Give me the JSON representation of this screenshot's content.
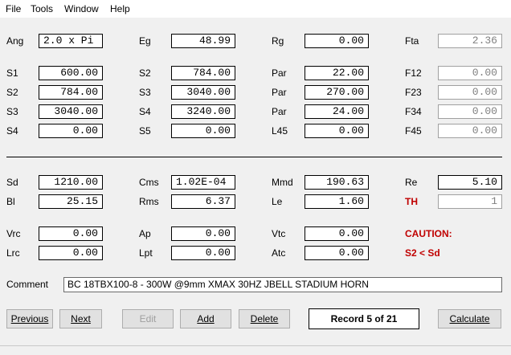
{
  "menu": [
    "File",
    "Tools",
    "Window",
    "Help"
  ],
  "rows": [
    [
      {
        "label": "Ang",
        "value": "2.0 x Pi",
        "align": "left"
      },
      {
        "label": "Eg",
        "value": "48.99"
      },
      {
        "label": "Rg",
        "value": "0.00"
      },
      {
        "label": "Fta",
        "value": "2.36",
        "readonly": true
      }
    ],
    [
      {
        "label": "S1",
        "value": "600.00"
      },
      {
        "label": "S2",
        "value": "784.00"
      },
      {
        "label": "Par",
        "value": "22.00"
      },
      {
        "label": "F12",
        "value": "0.00",
        "readonly": true
      }
    ],
    [
      {
        "label": "S2",
        "value": "784.00"
      },
      {
        "label": "S3",
        "value": "3040.00"
      },
      {
        "label": "Par",
        "value": "270.00"
      },
      {
        "label": "F23",
        "value": "0.00",
        "readonly": true
      }
    ],
    [
      {
        "label": "S3",
        "value": "3040.00"
      },
      {
        "label": "S4",
        "value": "3240.00"
      },
      {
        "label": "Par",
        "value": "24.00"
      },
      {
        "label": "F34",
        "value": "0.00",
        "readonly": true
      }
    ],
    [
      {
        "label": "S4",
        "value": "0.00"
      },
      {
        "label": "S5",
        "value": "0.00"
      },
      {
        "label": "L45",
        "value": "0.00"
      },
      {
        "label": "F45",
        "value": "0.00",
        "readonly": true
      }
    ],
    [
      {
        "label": "Sd",
        "value": "1210.00"
      },
      {
        "label": "Cms",
        "value": "1.02E-04",
        "align": "left"
      },
      {
        "label": "Mmd",
        "value": "190.63"
      },
      {
        "label": "Re",
        "value": "5.10"
      }
    ],
    [
      {
        "label": "Bl",
        "value": "25.15"
      },
      {
        "label": "Rms",
        "value": "6.37"
      },
      {
        "label": "Le",
        "value": "1.60"
      },
      {
        "label": "TH",
        "value": "1",
        "readonly": true,
        "red": true
      }
    ],
    [
      {
        "label": "Vrc",
        "value": "0.00"
      },
      {
        "label": "Ap",
        "value": "0.00"
      },
      {
        "label": "Vtc",
        "value": "0.00"
      },
      {
        "label": "CAUTION:",
        "red": true,
        "nofield": true
      }
    ],
    [
      {
        "label": "Lrc",
        "value": "0.00"
      },
      {
        "label": "Lpt",
        "value": "0.00"
      },
      {
        "label": "Atc",
        "value": "0.00"
      },
      {
        "label": "S2 < Sd",
        "red": true,
        "nofield": true
      }
    ]
  ],
  "comment": {
    "label": "Comment",
    "value": "BC 18TBX100-8  - 300W @9mm XMAX 30HZ JBELL STADIUM HORN"
  },
  "buttons": {
    "previous": "Previous",
    "next": "Next",
    "edit": "Edit",
    "add": "Add",
    "delete": "Delete",
    "calculate": "Calculate"
  },
  "record": "Record 5 of 21"
}
